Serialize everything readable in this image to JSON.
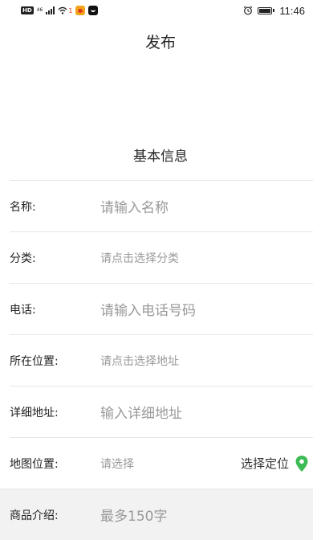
{
  "status_bar": {
    "hd": "HD",
    "network": "46",
    "notification_count": "1",
    "time": "11:46"
  },
  "header": {
    "title": "发布"
  },
  "section": {
    "title": "基本信息"
  },
  "form": {
    "name": {
      "label": "名称:",
      "placeholder": "请输入名称"
    },
    "category": {
      "label": "分类:",
      "placeholder": "请点击选择分类"
    },
    "phone": {
      "label": "电话:",
      "placeholder": "请输入电话号码"
    },
    "location": {
      "label": "所在位置:",
      "placeholder": "请点击选择地址"
    },
    "address": {
      "label": "详细地址:",
      "placeholder": "输入详细地址"
    },
    "map": {
      "label": "地图位置:",
      "placeholder": "请选择",
      "action": "选择定位"
    },
    "intro": {
      "label": "商品介绍:",
      "placeholder": "最多150字"
    }
  },
  "colors": {
    "pin": "#3dbb55",
    "placeholder": "#999999",
    "divider": "#e6e6e6",
    "intro_bg": "#f2f2f2"
  },
  "icons": [
    "hd-icon",
    "signal-icon",
    "wifi-icon",
    "weibo-app-icon",
    "app-icon",
    "alarm-icon",
    "battery-icon",
    "location-pin-icon"
  ]
}
